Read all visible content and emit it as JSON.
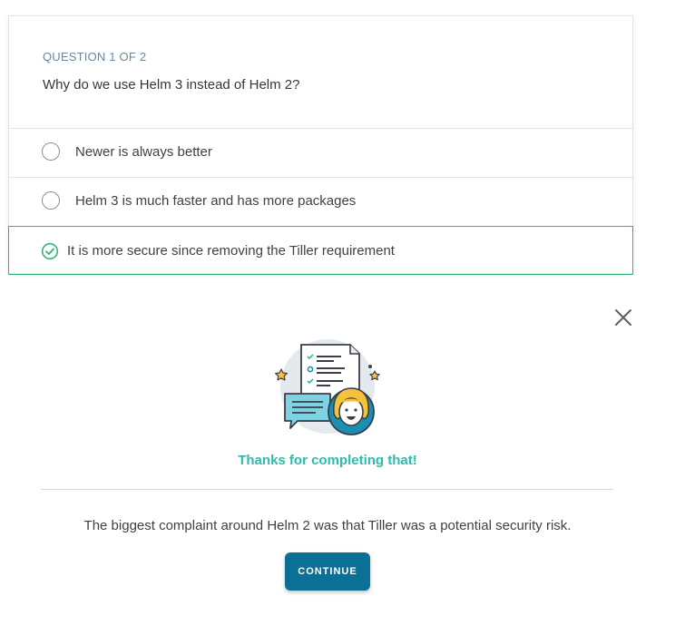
{
  "quiz": {
    "counter": "QUESTION 1 OF 2",
    "question": "Why do we use Helm 3 instead of Helm 2?",
    "options": [
      {
        "label": "Newer is always better",
        "state": "unselected"
      },
      {
        "label": "Helm 3 is much faster and has more packages",
        "state": "unselected"
      },
      {
        "label": "It is more secure since removing the Tiller requirement",
        "state": "correct"
      }
    ]
  },
  "feedback": {
    "title": "Thanks for completing that!",
    "explanation": "The biggest complaint around Helm 2 was that Tiller was a potential security risk.",
    "continue_label": "CONTINUE"
  },
  "icons": {
    "close": "close-icon",
    "check": "check-circle-icon",
    "illustration": "quiz-complete-illustration"
  },
  "colors": {
    "correct": "#34b37b",
    "thanks": "#2bbcaa",
    "button": "#0a7095",
    "counter": "#6b8799"
  }
}
